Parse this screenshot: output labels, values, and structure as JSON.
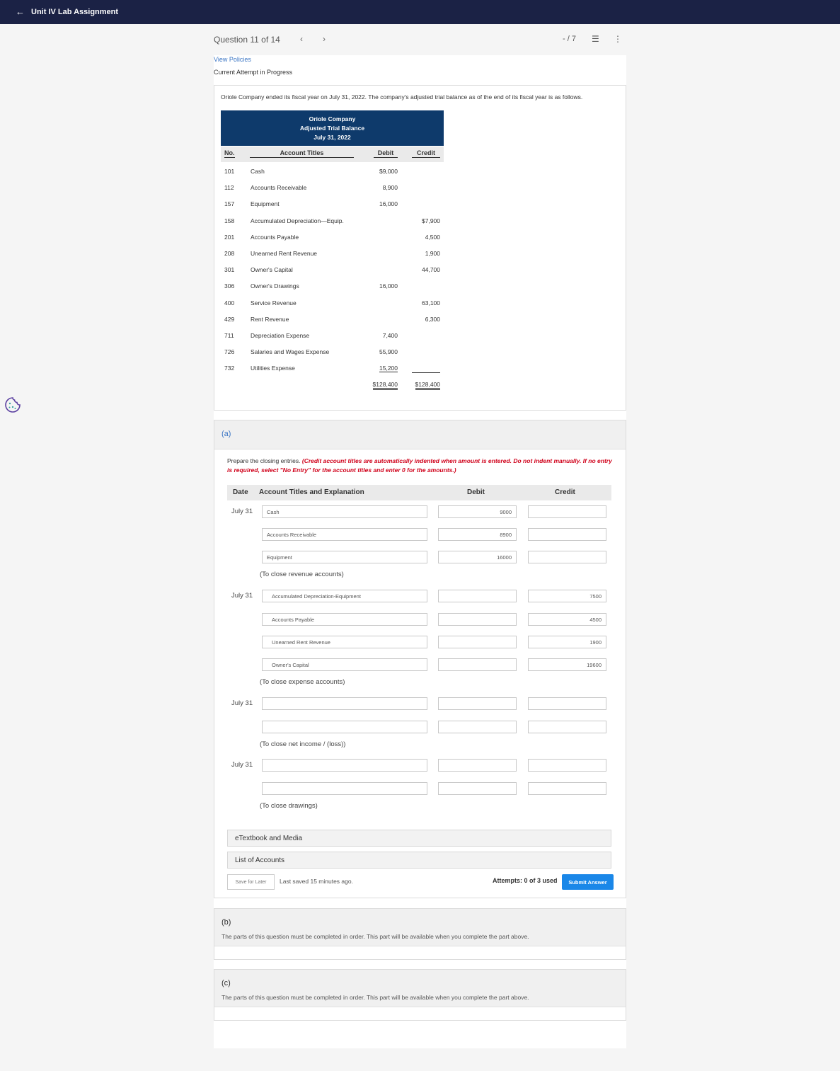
{
  "topbar": {
    "back_icon": "←",
    "title": "Unit IV Lab Assignment"
  },
  "nav": {
    "question_text": "Question 11 of 14",
    "prev": "‹",
    "next": "›",
    "score": "- / 7",
    "list_icon": "☰",
    "more_icon": "⋮"
  },
  "policies": "View Policies",
  "attempt_status": "Current Attempt in Progress",
  "problem": {
    "text": "Oriole Company ended its fiscal year on July 31, 2022. The company's adjusted trial balance as of the end of its fiscal year is as follows.",
    "tb_title1": "Oriole Company",
    "tb_title2": "Adjusted Trial Balance",
    "tb_title3": "July 31, 2022",
    "col_no": "No.",
    "col_titles": "Account Titles",
    "col_debit": "Debit",
    "col_credit": "Credit",
    "rows": [
      {
        "no": "101",
        "acct": "Cash",
        "debit": "$9,000",
        "credit": ""
      },
      {
        "no": "112",
        "acct": "Accounts Receivable",
        "debit": "8,900",
        "credit": ""
      },
      {
        "no": "157",
        "acct": "Equipment",
        "debit": "16,000",
        "credit": ""
      },
      {
        "no": "158",
        "acct": "Accumulated Depreciation—Equip.",
        "debit": "",
        "credit": "$7,900"
      },
      {
        "no": "201",
        "acct": "Accounts Payable",
        "debit": "",
        "credit": "4,500"
      },
      {
        "no": "208",
        "acct": "Unearned Rent Revenue",
        "debit": "",
        "credit": "1,900"
      },
      {
        "no": "301",
        "acct": "Owner's Capital",
        "debit": "",
        "credit": "44,700"
      },
      {
        "no": "306",
        "acct": "Owner's Drawings",
        "debit": "16,000",
        "credit": ""
      },
      {
        "no": "400",
        "acct": "Service Revenue",
        "debit": "",
        "credit": "63,100"
      },
      {
        "no": "429",
        "acct": "Rent Revenue",
        "debit": "",
        "credit": "6,300"
      },
      {
        "no": "711",
        "acct": "Depreciation Expense",
        "debit": "7,400",
        "credit": ""
      },
      {
        "no": "726",
        "acct": "Salaries and Wages Expense",
        "debit": "55,900",
        "credit": ""
      },
      {
        "no": "732",
        "acct": "Utilities Expense",
        "debit": "15,200",
        "credit": ""
      }
    ],
    "total_debit": "$128,400",
    "total_credit": "$128,400"
  },
  "part_a": {
    "label": "(a)",
    "instruction": "Prepare the closing entries.",
    "instruction_red": "(Credit account titles are automatically indented when amount is entered. Do not indent manually. If no entry is required, select \"No Entry\" for the account titles and enter 0 for the amounts.)",
    "col_date": "Date",
    "col_titles": "Account Titles and Explanation",
    "col_debit": "Debit",
    "col_credit": "Credit",
    "entries": [
      {
        "date": "July 31",
        "lines": [
          {
            "acct": "Cash",
            "debit": "9000",
            "credit": ""
          },
          {
            "acct": "Accounts Receivable",
            "debit": "8900",
            "credit": ""
          },
          {
            "acct": "Equipment",
            "debit": "16000",
            "credit": ""
          }
        ],
        "note": "(To close revenue accounts)"
      },
      {
        "date": "July 31",
        "lines": [
          {
            "acct": "Accumulated Depreciation-Equipment",
            "debit": "",
            "credit": "7500"
          },
          {
            "acct": "Accounts Payable",
            "debit": "",
            "credit": "4500"
          },
          {
            "acct": "Unearned Rent Revenue",
            "debit": "",
            "credit": "1900"
          },
          {
            "acct": "Owner's Capital",
            "debit": "",
            "credit": "19600"
          }
        ],
        "note": "(To close expense accounts)"
      },
      {
        "date": "July 31",
        "lines": [
          {
            "acct": "",
            "debit": "",
            "credit": ""
          },
          {
            "acct": "",
            "debit": "",
            "credit": ""
          }
        ],
        "note": "(To close net income / (loss))"
      },
      {
        "date": "July 31",
        "lines": [
          {
            "acct": "",
            "debit": "",
            "credit": ""
          },
          {
            "acct": "",
            "debit": "",
            "credit": ""
          }
        ],
        "note": "(To close drawings)"
      }
    ],
    "etextbook": "eTextbook and Media",
    "list_accounts": "List of Accounts",
    "save_later": "Save for Later",
    "last_saved": "Last saved 15 minutes ago.",
    "attempts": "Attempts: 0 of 3 used",
    "submit": "Submit Answer"
  },
  "part_b": {
    "label": "(b)",
    "message": "The parts of this question must be completed in order. This part will be available when you complete the part above."
  },
  "part_c": {
    "label": "(c)",
    "message": "The parts of this question must be completed in order. This part will be available when you complete the part above."
  },
  "colors": {
    "topbar": "#1b2245",
    "table_header": "#0e3a6b",
    "link": "#3a75c4",
    "warning": "#d0021b",
    "submit": "#1a87e8"
  }
}
